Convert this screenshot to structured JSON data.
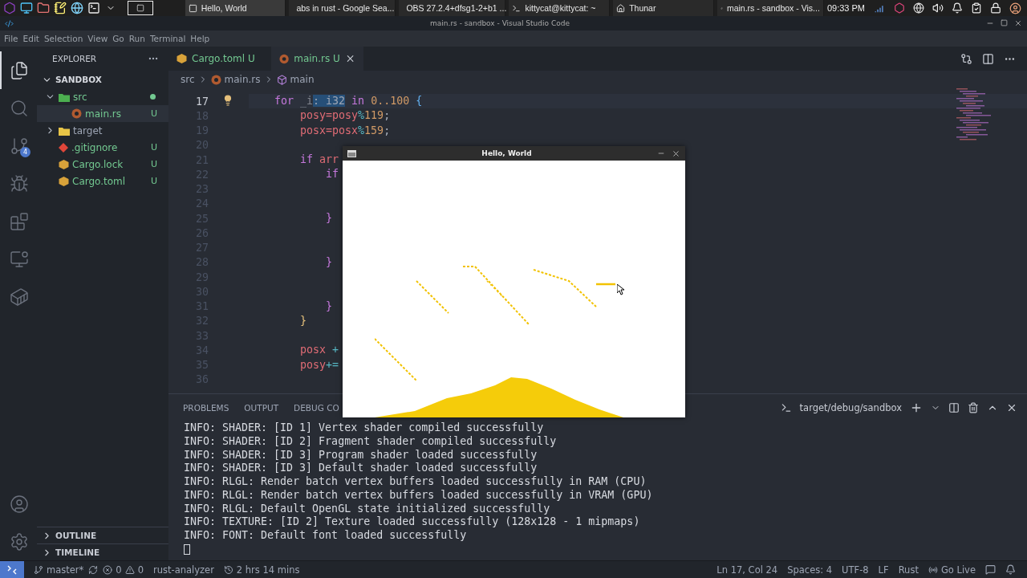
{
  "taskbar": {
    "tasks": [
      {
        "title": "Hello, World",
        "selected": true
      },
      {
        "title": "abs in rust - Google Sea...",
        "selected": false
      },
      {
        "title": "OBS 27.2.4+dfsg1-2+b1 ...",
        "selected": false
      },
      {
        "title": "kittycat@kittycat: ~",
        "selected": false
      },
      {
        "title": "Thunar",
        "selected": false
      },
      {
        "title": "main.rs - sandbox - Vis...",
        "selected": false
      }
    ],
    "clock": "09:33 PM"
  },
  "window": {
    "title": "main.rs - sandbox - Visual Studio Code"
  },
  "menu": [
    "File",
    "Edit",
    "Selection",
    "View",
    "Go",
    "Run",
    "Terminal",
    "Help"
  ],
  "activity_bar": {
    "items": [
      {
        "selected": true
      },
      {
        "selected": false
      },
      {
        "selected": false,
        "badge": "4"
      },
      {
        "selected": false
      },
      {
        "selected": false
      },
      {
        "selected": false
      },
      {
        "selected": false
      }
    ]
  },
  "sidebar": {
    "title": "EXPLORER",
    "folder": {
      "name": "SANDBOX",
      "expanded": true
    },
    "tree": [
      {
        "name": "src",
        "kind": "src-folder",
        "expanded": true,
        "modified": true,
        "children": [
          {
            "name": "main.rs",
            "kind": "rust",
            "status": "U",
            "selected": true
          }
        ]
      },
      {
        "name": "target",
        "kind": "folder",
        "expanded": false
      },
      {
        "name": ".gitignore",
        "kind": "git",
        "status": "U",
        "selected": false
      },
      {
        "name": "Cargo.lock",
        "kind": "cargo",
        "status": "U",
        "selected": false
      },
      {
        "name": "Cargo.toml",
        "kind": "cargo",
        "status": "U",
        "selected": false
      }
    ],
    "sections": [
      {
        "name": "OUTLINE",
        "expanded": false
      },
      {
        "name": "TIMELINE",
        "expanded": false
      }
    ]
  },
  "editor": {
    "tabs": [
      {
        "label": "Cargo.toml",
        "kind": "cargo",
        "status": "U",
        "selected": false
      },
      {
        "label": "main.rs",
        "kind": "rust",
        "status": "U",
        "selected": true
      }
    ],
    "breadcrumbs": [
      "src",
      "main.rs",
      "main"
    ],
    "lines": [
      {
        "number": "17",
        "current": true,
        "tokens": [
          {
            "text": "    for ",
            "kind": "keyword"
          },
          {
            "text": "_i",
            "kind": "dim"
          },
          {
            "text": ": i32",
            "kind": "hint"
          },
          {
            "text": " in ",
            "kind": "keyword"
          },
          {
            "text": "0..100 ",
            "kind": "number"
          },
          {
            "text": "{",
            "kind": "brace3"
          }
        ]
      },
      {
        "number": "18",
        "current": false,
        "tokens": [
          {
            "text": "        posy=posy",
            "kind": "variable"
          },
          {
            "text": "%",
            "kind": "operator"
          },
          {
            "text": "119",
            "kind": "number"
          },
          {
            "text": ";",
            "kind": "plain"
          }
        ]
      },
      {
        "number": "19",
        "current": false,
        "tokens": [
          {
            "text": "        posx=posx",
            "kind": "variable"
          },
          {
            "text": "%",
            "kind": "operator"
          },
          {
            "text": "159",
            "kind": "number"
          },
          {
            "text": ";",
            "kind": "plain"
          }
        ]
      },
      {
        "number": "20",
        "current": false
      },
      {
        "number": "21",
        "current": false,
        "tokens": [
          {
            "text": "        if ",
            "kind": "keyword"
          },
          {
            "text": "arr",
            "kind": "variable"
          }
        ]
      },
      {
        "number": "22",
        "current": false,
        "tokens": [
          {
            "text": "            if",
            "kind": "keyword"
          }
        ]
      },
      {
        "number": "23",
        "current": false
      },
      {
        "number": "24",
        "current": false
      },
      {
        "number": "25",
        "current": false,
        "tokens": [
          {
            "text": "            }",
            "kind": "brace2"
          }
        ]
      },
      {
        "number": "26",
        "current": false
      },
      {
        "number": "27",
        "current": false
      },
      {
        "number": "28",
        "current": false,
        "tokens": [
          {
            "text": "            }",
            "kind": "brace2"
          }
        ]
      },
      {
        "number": "29",
        "current": false
      },
      {
        "number": "30",
        "current": false
      },
      {
        "number": "31",
        "current": false,
        "tokens": [
          {
            "text": "            }",
            "kind": "brace2"
          }
        ]
      },
      {
        "number": "32",
        "current": false,
        "tokens": [
          {
            "text": "        }",
            "kind": "brace1"
          }
        ]
      },
      {
        "number": "33",
        "current": false
      },
      {
        "number": "34",
        "current": false,
        "tokens": [
          {
            "text": "        posx ",
            "kind": "variable"
          },
          {
            "text": "+",
            "kind": "operator"
          }
        ]
      },
      {
        "number": "35",
        "current": false,
        "tokens": [
          {
            "text": "        posy",
            "kind": "variable"
          },
          {
            "text": "+=",
            "kind": "operator"
          }
        ]
      },
      {
        "number": "36",
        "current": false
      }
    ]
  },
  "app_window": {
    "title": "Hello, World"
  },
  "panel": {
    "tabs": [
      {
        "label": "PROBLEMS",
        "selected": false
      },
      {
        "label": "OUTPUT",
        "selected": false
      },
      {
        "label": "DEBUG CO",
        "selected": false
      }
    ],
    "terminal_name": "target/debug/sandbox",
    "lines": [
      "INFO: SHADER: [ID 1] Vertex shader compiled successfully",
      "INFO: SHADER: [ID 2] Fragment shader compiled successfully",
      "INFO: SHADER: [ID 3] Program shader loaded successfully",
      "INFO: SHADER: [ID 3] Default shader loaded successfully",
      "INFO: RLGL: Render batch vertex buffers loaded successfully in RAM (CPU)",
      "INFO: RLGL: Render batch vertex buffers loaded successfully in VRAM (GPU)",
      "INFO: RLGL: Default OpenGL state initialized successfully",
      "INFO: TEXTURE: [ID 2] Texture loaded successfully (128x128 - 1 mipmaps)",
      "INFO: FONT: Default font loaded successfully"
    ]
  },
  "status_bar": {
    "branch": "master*",
    "errors": "0",
    "warnings": "0",
    "language_server": "rust-analyzer",
    "session_time": "2 hrs 14 mins",
    "position": "Ln 17, Col 24",
    "indentation": "Spaces: 4",
    "encoding": "UTF-8",
    "line_ending": "LF",
    "language": "Rust",
    "live_server": "Go Live"
  }
}
